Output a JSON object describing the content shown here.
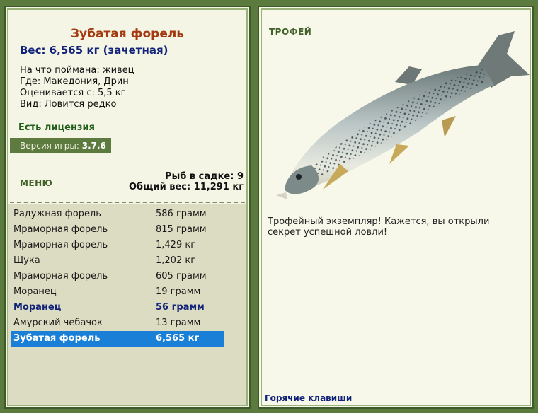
{
  "left_panel": {
    "fish_name": "Зубатая форель",
    "weight_line": "Вес: 6,565 кг (зачетная)",
    "details": [
      "На что поймана: живец",
      "Где: Македония, Дрин",
      "Оценивается с: 5,5 кг",
      "Вид: Ловится редко"
    ],
    "license": "Есть лицензия",
    "version_label": "Версия игры:",
    "version_value": "3.7.6",
    "menu_label": "МЕНЮ",
    "fish_count": "Рыб в садке: 9",
    "total_weight": "Общий вес: 11,291 кг"
  },
  "catch_list": [
    {
      "name": "Радужная форель",
      "weight": "586 грамм"
    },
    {
      "name": "Мраморная форель",
      "weight": "815 грамм"
    },
    {
      "name": "Мраморная форель",
      "weight": "1,429 кг"
    },
    {
      "name": "Щука",
      "weight": "1,202 кг"
    },
    {
      "name": "Мраморная форель",
      "weight": "605 грамм"
    },
    {
      "name": "Моранец",
      "weight": "19 грамм"
    },
    {
      "name": "Моранец",
      "weight": "56 грамм"
    },
    {
      "name": "Амурский чебачок",
      "weight": "13 грамм"
    },
    {
      "name": "Зубатая форель",
      "weight": "6,565 кг"
    }
  ],
  "right_panel": {
    "trophy_label": "ТРОФЕЙ",
    "description": "Трофейный экземпляр! Кажется, вы открыли секрет успешной ловли!",
    "hotkeys_link": "Горячие клавиши"
  },
  "colors": {
    "background": "#5b7a3e",
    "title": "#a43a10",
    "accent_blue": "#12237a",
    "selection": "#1a7fd6"
  }
}
